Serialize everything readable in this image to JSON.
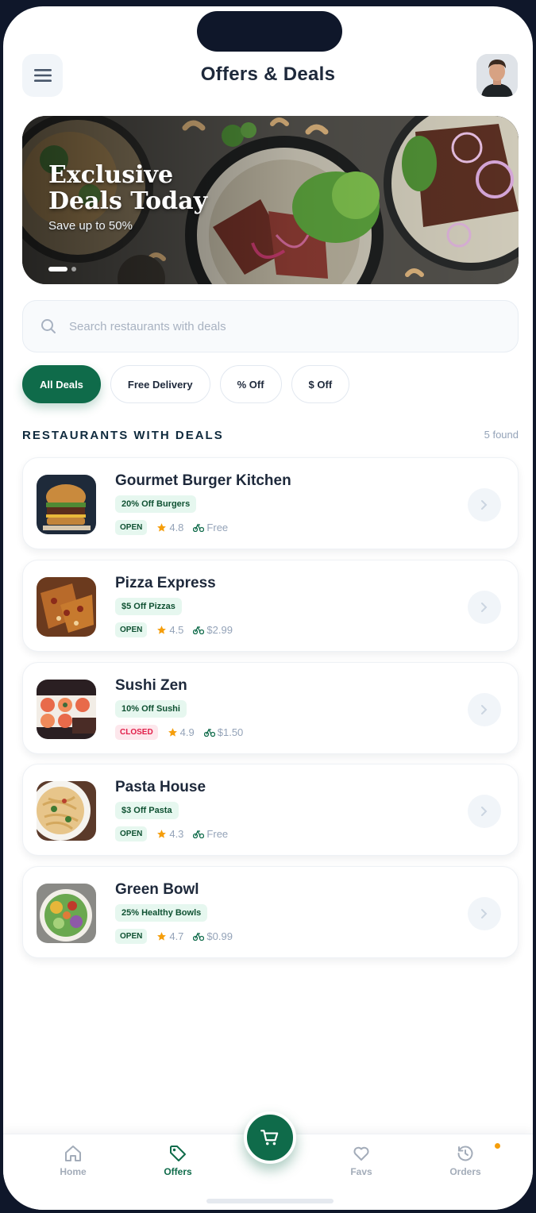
{
  "header": {
    "title": "Offers & Deals",
    "menu_icon": "menu-icon",
    "avatar_icon": "user-avatar"
  },
  "hero": {
    "title": "Exclusive Deals Today",
    "subtitle": "Save up to 50%",
    "slide_count": 2,
    "active_slide": 1
  },
  "search": {
    "placeholder": "Search restaurants with deals",
    "value": ""
  },
  "filters": [
    {
      "label": "All Deals",
      "active": true
    },
    {
      "label": "Free Delivery",
      "active": false
    },
    {
      "label": "% Off",
      "active": false
    },
    {
      "label": "$ Off",
      "active": false
    }
  ],
  "section": {
    "title": "RESTAURANTS WITH DEALS",
    "count": "5 found"
  },
  "restaurants": [
    {
      "name": "Gourmet Burger Kitchen",
      "deal": "20% Off Burgers",
      "status": "OPEN",
      "rating": "4.8",
      "delivery": "Free",
      "image": "burger"
    },
    {
      "name": "Pizza Express",
      "deal": "$5 Off Pizzas",
      "status": "OPEN",
      "rating": "4.5",
      "delivery": "$2.99",
      "image": "pizza"
    },
    {
      "name": "Sushi Zen",
      "deal": "10% Off Sushi",
      "status": "CLOSED",
      "rating": "4.9",
      "delivery": "$1.50",
      "image": "sushi"
    },
    {
      "name": "Pasta House",
      "deal": "$3 Off Pasta",
      "status": "OPEN",
      "rating": "4.3",
      "delivery": "Free",
      "image": "pasta"
    },
    {
      "name": "Green Bowl",
      "deal": "25% Healthy Bowls",
      "status": "OPEN",
      "rating": "4.7",
      "delivery": "$0.99",
      "image": "salad"
    }
  ],
  "nav": {
    "items": [
      {
        "label": "Home",
        "icon": "home-icon",
        "active": false
      },
      {
        "label": "Offers",
        "icon": "tag-icon",
        "active": true
      },
      {
        "label": "Favs",
        "icon": "heart-icon",
        "active": false
      },
      {
        "label": "Orders",
        "icon": "history-icon",
        "active": false
      }
    ],
    "fab_icon": "cart-icon"
  },
  "colors": {
    "brand": "#0f6b4a",
    "title": "#1e293b",
    "closed": "#e11d48",
    "star": "#f59e0b"
  }
}
